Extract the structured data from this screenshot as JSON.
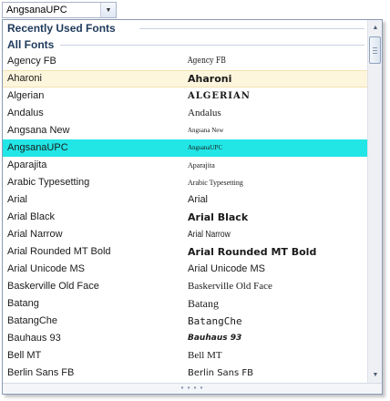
{
  "combo": {
    "value": "AngsanaUPC",
    "dropdown_icon": "triangle-down-icon"
  },
  "sections": {
    "recent": "Recently Used Fonts",
    "all": "All Fonts"
  },
  "fonts": [
    {
      "name": "Agency FB",
      "preview": "Agency FB",
      "state": "normal"
    },
    {
      "name": "Aharoni",
      "preview": "Aharoni",
      "state": "hover"
    },
    {
      "name": "Algerian",
      "preview": "ALGERIAN",
      "state": "normal"
    },
    {
      "name": "Andalus",
      "preview": "Andalus",
      "state": "normal"
    },
    {
      "name": "Angsana New",
      "preview": "Angsana New",
      "state": "normal"
    },
    {
      "name": "AngsanaUPC",
      "preview": "AngsanaUPC",
      "state": "selected"
    },
    {
      "name": "Aparajita",
      "preview": "Aparajita",
      "state": "normal"
    },
    {
      "name": "Arabic Typesetting",
      "preview": "Arabic Typesetting",
      "state": "normal"
    },
    {
      "name": "Arial",
      "preview": "Arial",
      "state": "normal"
    },
    {
      "name": "Arial Black",
      "preview": "Arial Black",
      "state": "normal"
    },
    {
      "name": "Arial Narrow",
      "preview": "Arial Narrow",
      "state": "normal"
    },
    {
      "name": "Arial Rounded MT Bold",
      "preview": "Arial Rounded MT Bold",
      "state": "normal"
    },
    {
      "name": "Arial Unicode MS",
      "preview": "Arial Unicode MS",
      "state": "normal"
    },
    {
      "name": "Baskerville Old Face",
      "preview": "Baskerville Old Face",
      "state": "normal"
    },
    {
      "name": "Batang",
      "preview": "Batang",
      "state": "normal"
    },
    {
      "name": "BatangChe",
      "preview": "BatangChe",
      "state": "normal"
    },
    {
      "name": "Bauhaus 93",
      "preview": "Bauhaus 93",
      "state": "normal"
    },
    {
      "name": "Bell MT",
      "preview": "Bell MT",
      "state": "normal"
    },
    {
      "name": "Berlin Sans FB",
      "preview": "Berlin Sans FB",
      "state": "normal"
    }
  ],
  "scrollbar": {
    "up_icon": "arrow-up-icon",
    "down_icon": "arrow-down-icon"
  },
  "grip": {
    "icon": "resize-grip-icon"
  },
  "colors": {
    "selected": "#22e6e6",
    "hover": "#fdf5dc",
    "section_text": "#1e395b"
  }
}
